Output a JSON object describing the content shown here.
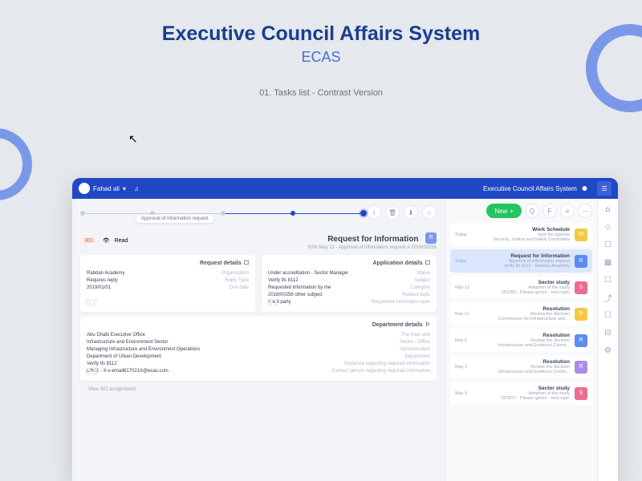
{
  "hero": {
    "title": "Executive Council Affairs System",
    "subtitle": "ECAS",
    "caption": "01. Tasks list - Contrast Version"
  },
  "topbar": {
    "user": "Fahad ali",
    "system_name": "Executive Council Affairs System"
  },
  "stepper": {
    "tooltip": "Approval of Information request"
  },
  "actions": {
    "new": "New"
  },
  "request": {
    "badge": "301",
    "read": "Read",
    "title": "Request for Information",
    "subtitle": "SSN May 12 - Approval of Information request   # 2018/00256",
    "badge_letter": "R"
  },
  "card_req": {
    "title": "Request details",
    "rows": [
      {
        "val": "Rabdan Academy",
        "lbl": "Organisation"
      },
      {
        "val": "Requires reply",
        "lbl": "Reply Type"
      },
      {
        "val": "2019/01/01",
        "lbl": "Due date"
      }
    ],
    "num": "02"
  },
  "card_app": {
    "title": "Application details",
    "rows": [
      {
        "val": "Under accreditation - Sector Manager",
        "lbl": "Status"
      },
      {
        "val": "Verify tfs 8112",
        "lbl": "Subject"
      },
      {
        "val": "Requested information by me",
        "lbl": "Category"
      },
      {
        "val": "2018/00256 other subject",
        "lbl": "Related topic"
      },
      {
        "val": "Third party",
        "lbl": "Requested information type"
      }
    ],
    "num": "01"
  },
  "card_dept": {
    "title": "Department details",
    "rows": [
      {
        "val": "Abu Dhabi Executive Office",
        "lbl": "The main unit"
      },
      {
        "val": "Infrastructure and Environment Sector",
        "lbl": "Sector / Office"
      },
      {
        "val": "Managing Infrastructure and Environment Operations",
        "lbl": "Administration"
      },
      {
        "val": "Department of Urban Development",
        "lbl": "Department"
      },
      {
        "val": "Verify tfs 8112",
        "lbl": "Evidence regarding required information"
      },
      {
        "val": "CR01 - X-v-email617021X@ecas.com",
        "lbl": "Contact person regarding required information"
      }
    ],
    "num": "03"
  },
  "list": [
    {
      "date": "Today",
      "title": "Work Schedule",
      "sub1": "start the agenda",
      "sub2": "Security, Justice and Safety Committee",
      "badge": "W",
      "color": "#f5c842"
    },
    {
      "date": "Today",
      "title": "Request for Information",
      "sub1": "Approval of information request",
      "sub2": "Verify tfs 8112 - Rabdan Academy",
      "badge": "R",
      "color": "#5b8def",
      "active": true
    },
    {
      "date": "May 12",
      "title": "Sector study",
      "sub1": "Adoption of the study",
      "sub2": "251283 - Please ignore - next topic",
      "badge": "S",
      "color": "#ec6b8f"
    },
    {
      "date": "May 11",
      "title": "Resolution",
      "sub1": "Review the decision",
      "sub2": "Commission for Infrastructure and ...",
      "badge": "R",
      "color": "#f5c842"
    },
    {
      "date": "May 6",
      "title": "Resolution",
      "sub1": "Review the decision",
      "sub2": "Infrastructure and Evidence Comm...",
      "badge": "R",
      "color": "#5b8def"
    },
    {
      "date": "May 1",
      "title": "Resolution",
      "sub1": "Review the decision",
      "sub2": "Infrastructure and Evidence Comm...",
      "badge": "R",
      "color": "#b088e8"
    },
    {
      "date": "May 1",
      "title": "Sector study",
      "sub1": "Adoption of the study",
      "sub2": "507971 - Please ignore - next topic",
      "badge": "S",
      "color": "#ec6b8f"
    }
  ],
  "footer": "View 301 assignments"
}
